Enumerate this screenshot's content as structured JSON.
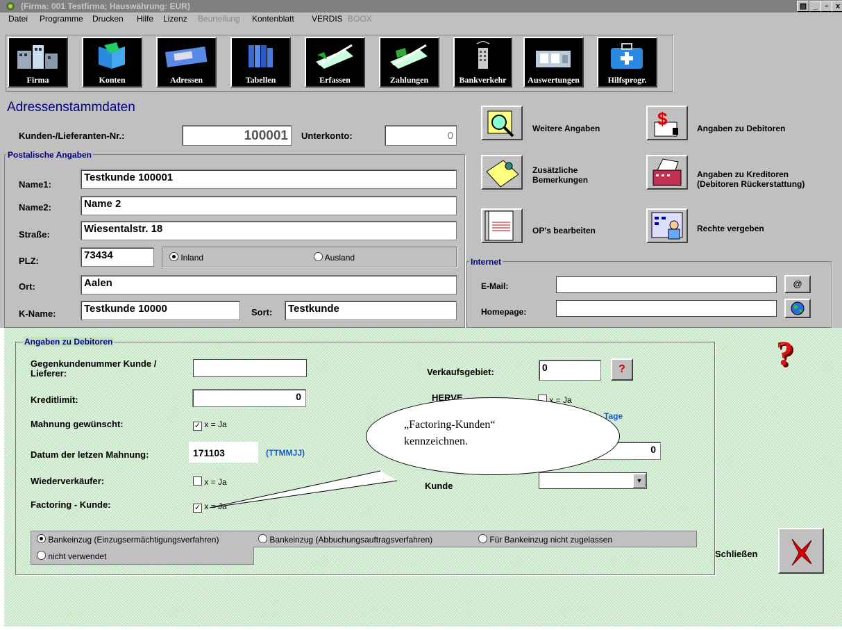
{
  "window": {
    "title": "(Firma: 001 Testfirma;  Hauswährung: EUR)",
    "controls": [
      "▤",
      "_",
      "▫",
      "x"
    ]
  },
  "menu": [
    {
      "label": "Datei",
      "enabled": true
    },
    {
      "label": "Programme",
      "enabled": true
    },
    {
      "label": "Drucken",
      "enabled": true
    },
    {
      "label": "Hilfe",
      "enabled": true
    },
    {
      "label": "Lizenz",
      "enabled": true
    },
    {
      "label": "Beurteilung",
      "enabled": false
    },
    {
      "label": "Kontenblatt",
      "enabled": true
    },
    {
      "label": "VERDIS",
      "enabled": true
    },
    {
      "label": "BOOX",
      "enabled": false
    }
  ],
  "toolbar": [
    "Firma",
    "Konten",
    "Adressen",
    "Tabellen",
    "Erfassen",
    "Zahlungen",
    "Bankverkehr",
    "Auswertungen",
    "Hilfsprogr."
  ],
  "form": {
    "title": "Adressenstammdaten",
    "kunden_nr_label": "Kunden-/Lieferanten-Nr.:",
    "kunden_nr_value": "100001",
    "unterkonto_label": "Unterkonto:",
    "unterkonto_value": "0",
    "postal": {
      "group_title": "Postalische Angaben",
      "name1_label": "Name1:",
      "name1_value": "Testkunde 100001",
      "name2_label": "Name2:",
      "name2_value": "Name 2",
      "strasse_label": "Straße:",
      "strasse_value": "Wiesentalstr. 18",
      "plz_label": "PLZ:",
      "plz_value": "73434",
      "inland_label": "Inland",
      "ausland_label": "Ausland",
      "ort_label": "Ort:",
      "ort_value": "Aalen",
      "kname_label": "K-Name:",
      "kname_value": "Testkunde 10000",
      "sort_label": "Sort:",
      "sort_value": "Testkunde"
    },
    "actions": {
      "weitere": "Weitere Angaben",
      "debitoren": "Angaben zu Debitoren",
      "bemerkungen": "Zusätzliche\nBemerkungen",
      "kreditoren": "Angaben zu Kreditoren\n(Debitoren Rückerstattung)",
      "ops": "OP's bearbeiten",
      "rechte": "Rechte vergeben"
    },
    "internet": {
      "group_title": "Internet",
      "email_label": "E-Mail:",
      "email_value": "",
      "homepage_label": "Homepage:",
      "homepage_value": "",
      "at_button": "@"
    }
  },
  "debitoren": {
    "group_title": "Angaben zu Debitoren",
    "gegenkunde_label": "Gegenkundenummer Kunde /\nLieferer:",
    "gegenkunde_value": "",
    "kreditlimit_label": "Kreditlimit:",
    "kreditlimit_value": "0",
    "mahnung_label": "Mahnung gewünscht:",
    "mahnung_checked": true,
    "xja": "x = Ja",
    "datum_label": "Datum der letzen Mahnung:",
    "datum_value": "171103",
    "datum_format": "(TTMMJJ)",
    "wiederverkaeufer_label": "Wiederverkäufer:",
    "wiederverkaeufer_checked": false,
    "factoring_label": "Factoring - Kunde:",
    "factoring_checked": true,
    "verkaufsgebiet_label": "Verkaufsgebiet:",
    "verkaufsgebiet_value": "0",
    "help_button": "?",
    "hidden_label_1": "HERVE",
    "tage_label": "Tage",
    "field_right_value": "0",
    "kunde_label": "Kunde",
    "bank_options": [
      "Bankeinzug (Einzugsermächtigungsverfahren)",
      "Bankeinzug (Abbuchungsauftragsverfahren)",
      "Für Bankeinzug nicht zugelassen",
      "nicht verwendet"
    ],
    "bank_selected": 0,
    "close_label": "Schließen"
  },
  "callout": {
    "text_line1": "„Factoring-Kunden“",
    "text_line2": "kennzeichnen."
  },
  "colors": {
    "title_blue": "#000080",
    "panel": "#c0c0c0",
    "green": "#c2e4c2",
    "red": "#cc0000"
  }
}
